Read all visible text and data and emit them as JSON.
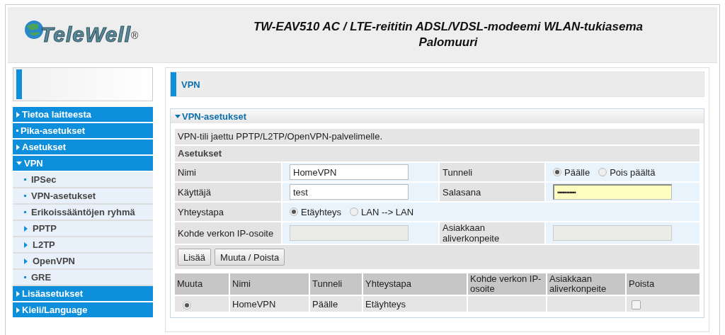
{
  "header": {
    "logo": "TeleWell",
    "registered_mark": "®",
    "title_line1": "TW-EAV510 AC / LTE-reititin ADSL/VDSL-modeemi WLAN-tukiasema",
    "title_line2": "Palomuuri"
  },
  "sidebar": {
    "items": [
      {
        "label": "Tietoa laitteesta",
        "kind": "arrow",
        "expanded": false
      },
      {
        "label": "Pika-asetukset",
        "kind": "dot"
      },
      {
        "label": "Asetukset",
        "kind": "arrow",
        "expanded": false
      },
      {
        "label": "VPN",
        "kind": "arrow",
        "expanded": true,
        "children": [
          {
            "label": "IPSec",
            "kind": "dot"
          },
          {
            "label": "VPN-asetukset",
            "kind": "dot"
          },
          {
            "label": "Erikoissääntöjen ryhmä",
            "kind": "dot"
          },
          {
            "label": "PPTP",
            "kind": "arrow"
          },
          {
            "label": "L2TP",
            "kind": "arrow"
          },
          {
            "label": "OpenVPN",
            "kind": "arrow"
          },
          {
            "label": "GRE",
            "kind": "dot"
          }
        ]
      },
      {
        "label": "Lisäasetukset",
        "kind": "arrow",
        "expanded": false
      },
      {
        "label": "Kieli/Language",
        "kind": "arrow",
        "expanded": false
      }
    ]
  },
  "page_title": "VPN",
  "section": {
    "title": "VPN-asetukset",
    "expanded": true,
    "description": "VPN-tili jaettu PPTP/L2TP/OpenVPN-palvelimelle.",
    "subheading": "Asetukset",
    "name_label": "Nimi",
    "name_value": "HomeVPN",
    "tunnel_label": "Tunneli",
    "tunnel_options": [
      {
        "label": "Päälle",
        "selected": true
      },
      {
        "label": "Pois päältä",
        "selected": false
      }
    ],
    "user_label": "Käyttäjä",
    "user_value": "test",
    "password_label": "Salasana",
    "password_value": "••••••••••••",
    "type_label": "Yhteystapa",
    "type_options": [
      {
        "label": "Etäyhteys",
        "selected": true
      },
      {
        "label": "LAN --> LAN",
        "selected": false
      }
    ],
    "remote_ip_label": "Kohde verkon IP-osoite",
    "subnet_label": "Asiakkaan aliverkonpeite",
    "buttons": [
      "Lisää",
      "Muuta / Poista"
    ]
  },
  "table": {
    "columns": [
      "Muuta",
      "Nimi",
      "Tunneli",
      "Yhteystapa",
      "Kohde verkon IP-osoite",
      "Asiakkaan aliverkonpeite",
      "Poista"
    ],
    "rows": [
      {
        "selected": true,
        "name": "HomeVPN",
        "tunnel": "Päälle",
        "type": "Etäyhteys",
        "delete_checked": false
      }
    ]
  }
}
